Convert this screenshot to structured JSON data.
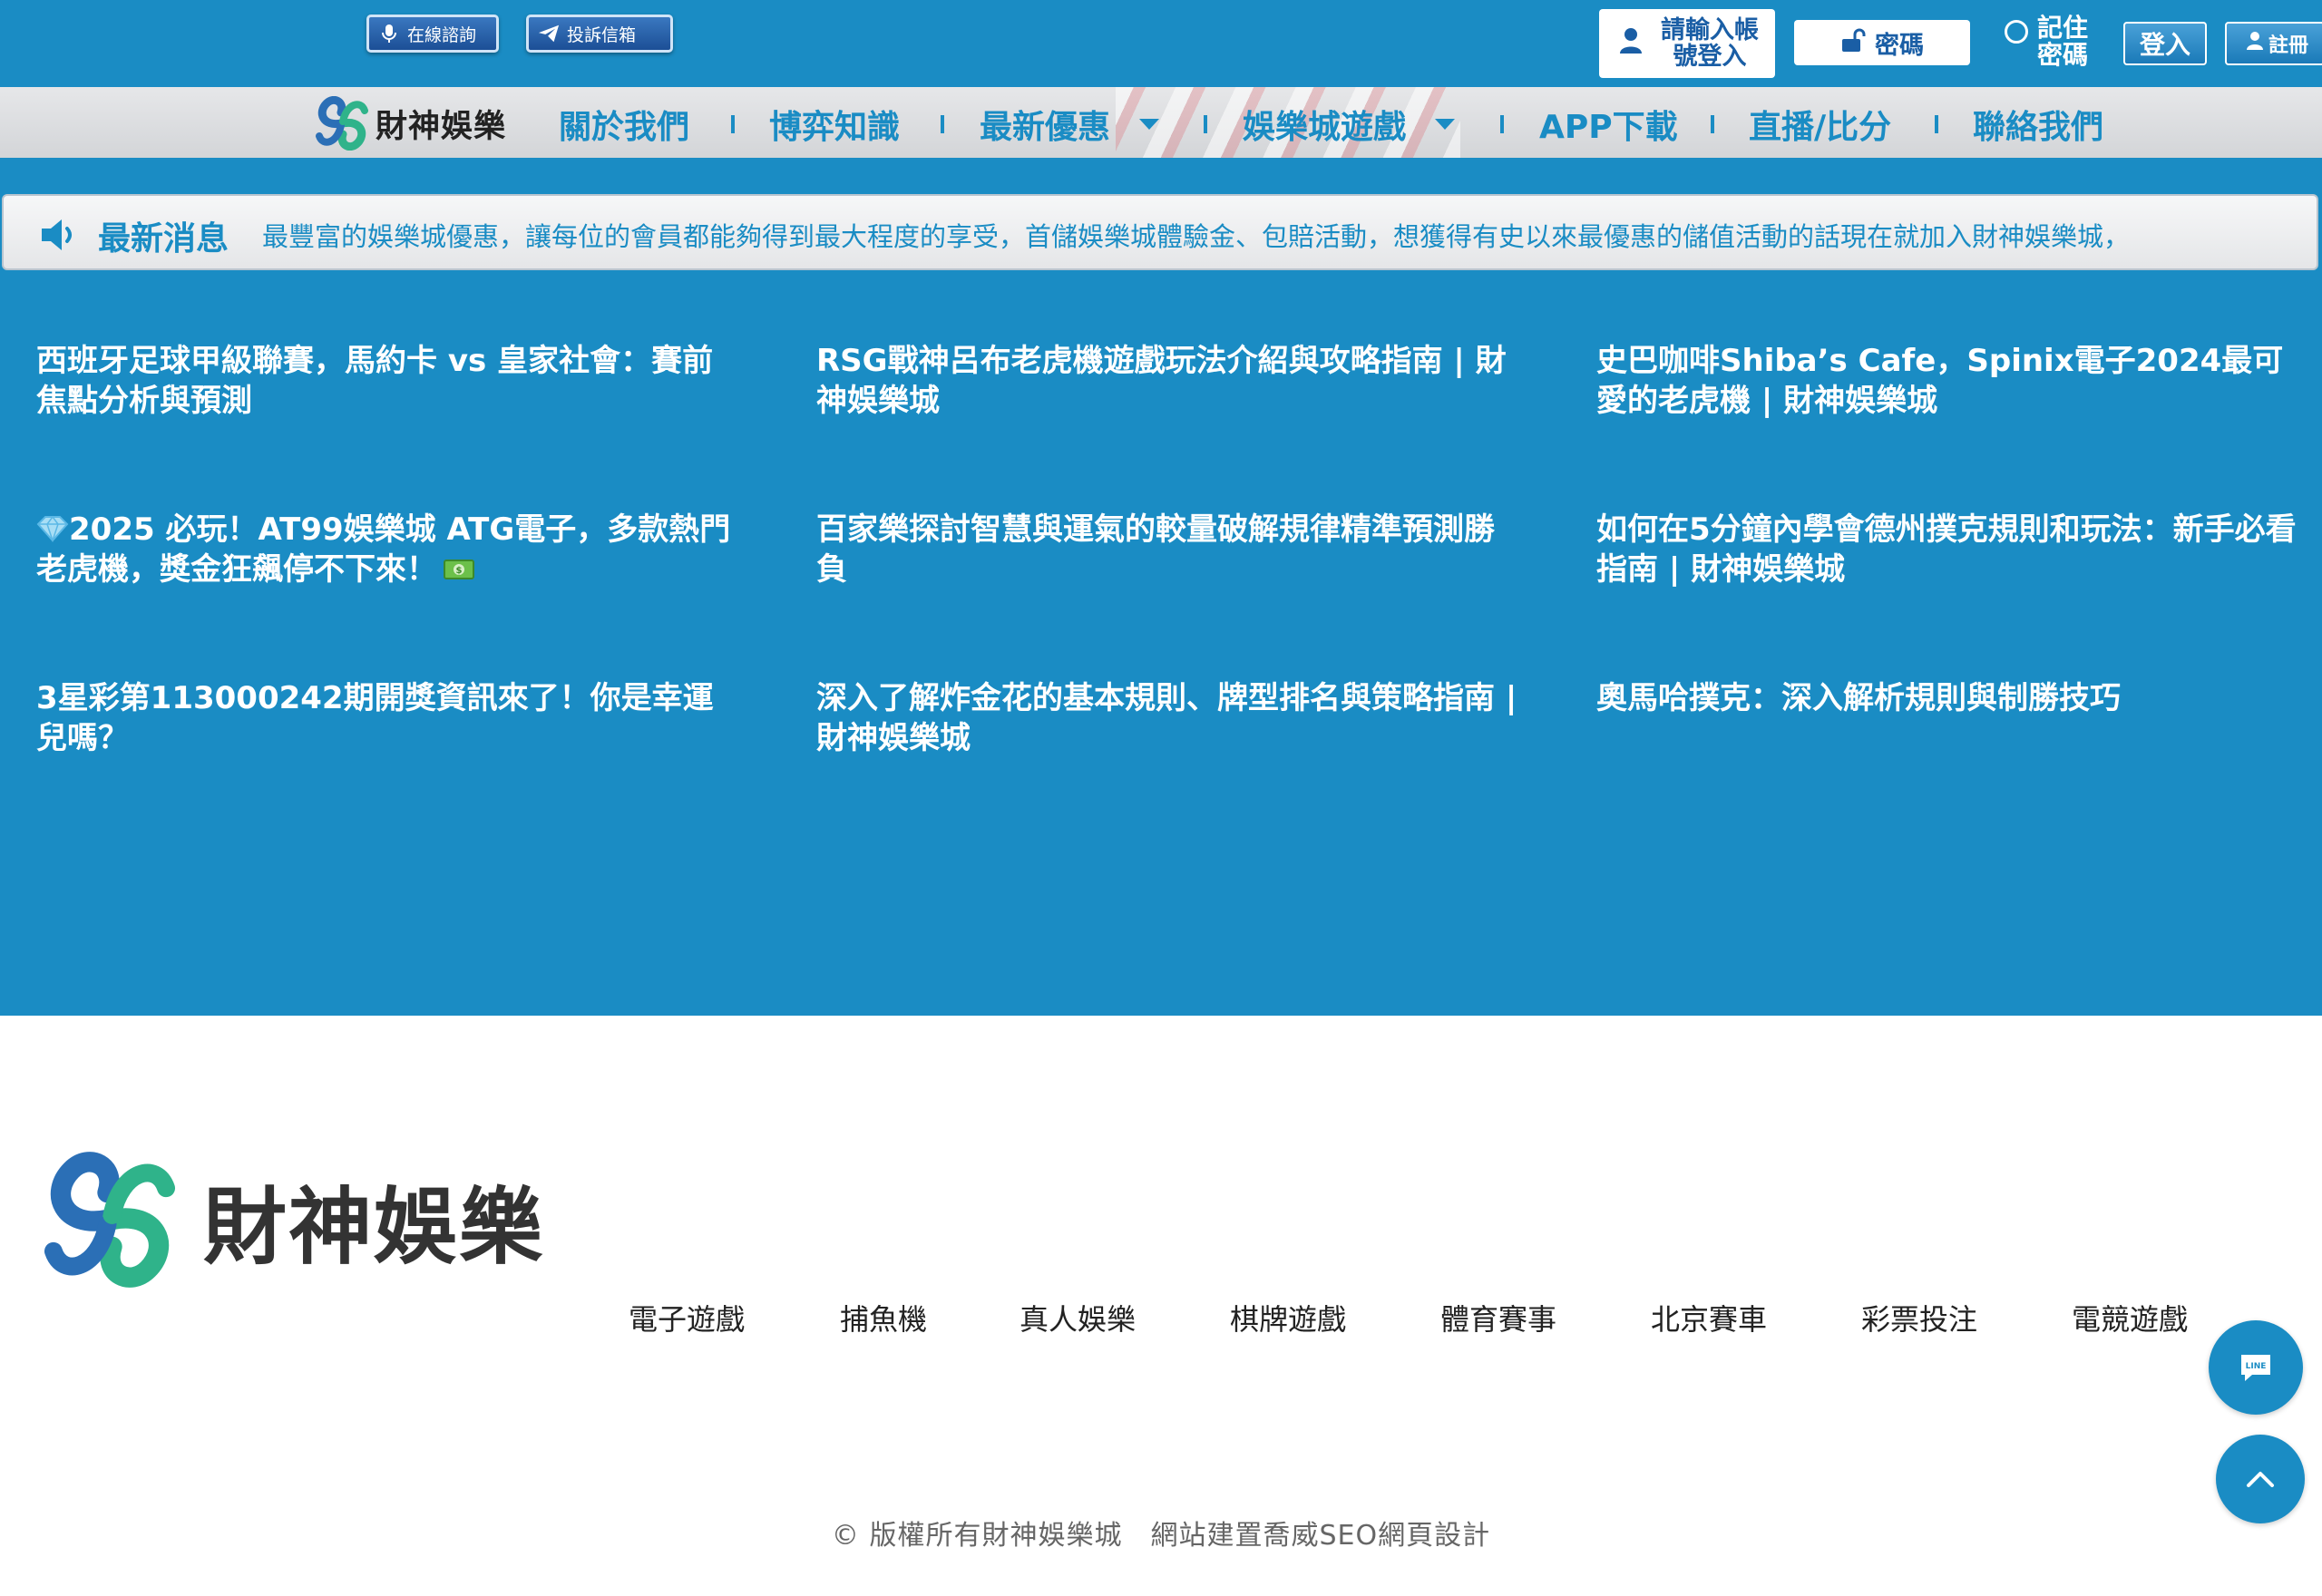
{
  "topbar": {
    "consult_label": "在線諮詢",
    "complaint_label": "投訴信箱",
    "account_placeholder": "請輸入帳號登入",
    "password_placeholder": "密碼",
    "remember_label": "記住密碼",
    "login_label": "登入",
    "register_label": "註冊"
  },
  "nav": {
    "logo_text": "財神娛樂",
    "items": [
      {
        "label": "關於我們"
      },
      {
        "label": "博弈知識"
      },
      {
        "label": "最新優惠"
      },
      {
        "label": "娛樂城遊戲"
      },
      {
        "label": "APP下載"
      },
      {
        "label": "直播/比分"
      },
      {
        "label": "聯絡我們"
      }
    ]
  },
  "ticker": {
    "label": "最新消息",
    "message": "最豐富的娛樂城優惠，讓每位的會員都能夠得到最大程度的享受，首儲娛樂城體驗金、包賠活動，想獲得有史以來最優惠的儲值活動的話現在就加入財神娛樂城，"
  },
  "articles": [
    {
      "title": "西班牙足球甲級聯賽，馬約卡 vs 皇家社會：賽前焦點分析與預測"
    },
    {
      "title": "RSG戰神呂布老虎機遊戲玩法介紹與攻略指南 | 財神娛樂城"
    },
    {
      "title": "史巴咖啡Shiba’s Cafe，Spinix電子2024最可愛的老虎機 | 財神娛樂城"
    },
    {
      "title": "2025 必玩！AT99娛樂城 ATG電子，多款熱門老虎機，獎金狂飆停不下來！"
    },
    {
      "title": "百家樂探討智慧與運氣的較量破解規律精準預測勝負"
    },
    {
      "title": "如何在5分鐘內學會德州撲克規則和玩法：新手必看指南 | 財神娛樂城"
    },
    {
      "title": "3星彩第113000242期開獎資訊來了！你是幸運兒嗎？"
    },
    {
      "title": "深入了解炸金花的基本規則、牌型排名與策略指南 | 財神娛樂城"
    },
    {
      "title": "奧馬哈撲克：深入解析規則與制勝技巧"
    }
  ],
  "footer": {
    "logo_text": "財神娛樂",
    "links": [
      {
        "label": "電子遊戲"
      },
      {
        "label": "捕魚機"
      },
      {
        "label": "真人娛樂"
      },
      {
        "label": "棋牌遊戲"
      },
      {
        "label": "體育賽事"
      },
      {
        "label": "北京賽車"
      },
      {
        "label": "彩票投注"
      },
      {
        "label": "電競遊戲"
      }
    ],
    "copyright": "© 版權所有財神娛樂城　網站建置喬威SEO網頁設計"
  },
  "icons": {
    "line_chat": "line-chat-icon",
    "to_top": "chevron-up-icon"
  },
  "colors": {
    "brand_blue": "#1a8cc4",
    "navbar_gray": "#dcdde0",
    "footer_bg": "#ffffff"
  }
}
